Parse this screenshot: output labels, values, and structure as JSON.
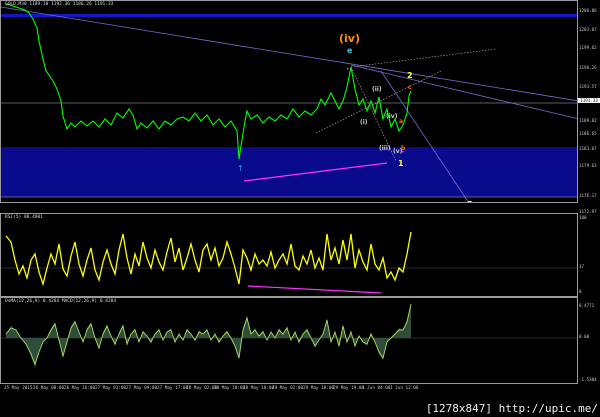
{
  "main": {
    "title": "GOLD,M30  1189.10 1192.36 1186.26 1191.33",
    "current_price": "1191.33",
    "price_ticks": [
      "1206.86",
      "1203.07",
      "1199.62",
      "1196.26",
      "1193.57",
      "1189.82",
      "1186.65",
      "1183.07",
      "1179.63",
      "1176.17",
      "1172.97"
    ],
    "wave_labels": {
      "iv": "(iv)",
      "e": "e",
      "two": "2",
      "c": "c",
      "ii": "(ii)",
      "i": "(i)",
      "iv_small": "(iv)",
      "a": "a",
      "iii": "(iii)",
      "v": "(v)",
      "b": "b",
      "one": "1",
      "five": "5"
    },
    "colors": {
      "up": "#00ff00",
      "band": "#0a0a8c",
      "arrow_up": "#1fa0ff",
      "magenta": "#ff33ff",
      "orange": "#ff8c00",
      "yellow": "#ffff33",
      "teal": "#40c0e0"
    }
  },
  "rsi": {
    "title": "RSI(5) 88.4901",
    "ticks": [
      "100",
      "37",
      "0"
    ]
  },
  "osma": {
    "title": "OsMA(12,26,9) 0.4284  MACD(12,26,9) 0.4284",
    "ticks": [
      "0.4771",
      "0.00",
      "-1.5304"
    ]
  },
  "time_labels": [
    "25 May 2015",
    "26 May 08:00",
    "26 May 16:00",
    "27 May 01:00",
    "27 May 09:00",
    "27 May 17:00",
    "28 May 02:00",
    "28 May 10:00",
    "28 May 18:00",
    "29 May 02:00",
    "29 May 10:00",
    "29 May 19:00",
    "1 Jun 04:00",
    "1 Jun 12:00"
  ],
  "footer": "[1278x847] http://upic.me/"
}
